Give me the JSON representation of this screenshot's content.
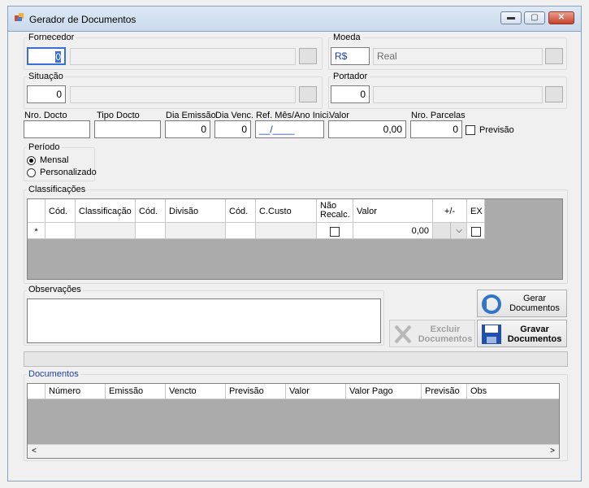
{
  "window": {
    "title": "Gerador de Documentos",
    "min": "▬",
    "max": "▢",
    "close": "✕"
  },
  "fornecedor": {
    "label": "Fornecedor",
    "code": "0",
    "name": ""
  },
  "moeda": {
    "label": "Moeda",
    "code": "R$",
    "name": "Real"
  },
  "situacao": {
    "label": "Situação",
    "code": "0",
    "name": ""
  },
  "portador": {
    "label": "Portador",
    "code": "0",
    "name": ""
  },
  "fields": {
    "nro_docto": {
      "label": "Nro. Docto",
      "value": ""
    },
    "tipo_docto": {
      "label": "Tipo Docto",
      "value": ""
    },
    "dia_emissao": {
      "label": "Dia Emissão",
      "value": "0"
    },
    "dia_venc": {
      "label": "Dia Venc.",
      "value": "0"
    },
    "ref": {
      "label": "Ref. Mês/Ano Inici.",
      "value": "__/____"
    },
    "valor": {
      "label": "Valor",
      "value": "0,00"
    },
    "nro_parcelas": {
      "label": "Nro. Parcelas",
      "value": "0"
    },
    "previsao": {
      "label": "Previsão",
      "checked": false
    }
  },
  "periodo": {
    "label": "Período",
    "options": [
      "Mensal",
      "Personalizado"
    ],
    "selected": "Mensal"
  },
  "classificacoes": {
    "label": "Classificações",
    "headers": [
      "Cód.",
      "Classificação",
      "Cód.",
      "Divisão",
      "Cód.",
      "C.Custo",
      "Não Recalc.",
      "Valor",
      "+/-",
      "EX"
    ],
    "new_row_marker": "*",
    "new_row_valor": "0,00"
  },
  "observacoes": {
    "label": "Observações",
    "value": ""
  },
  "buttons": {
    "gerar": "Gerar Documentos",
    "excluir": "Excluir Documentos",
    "gravar": "Gravar Documentos"
  },
  "documentos": {
    "label": "Documentos",
    "headers": [
      "Número",
      "Emissão",
      "Vencto",
      "Previsão",
      "Valor",
      "Valor Pago",
      "Previsão",
      "Obs"
    ],
    "scroll_left": "<",
    "scroll_right": ">"
  },
  "colors": {
    "link_label": "#1c3fa8",
    "focus": "#3a6fd8"
  }
}
